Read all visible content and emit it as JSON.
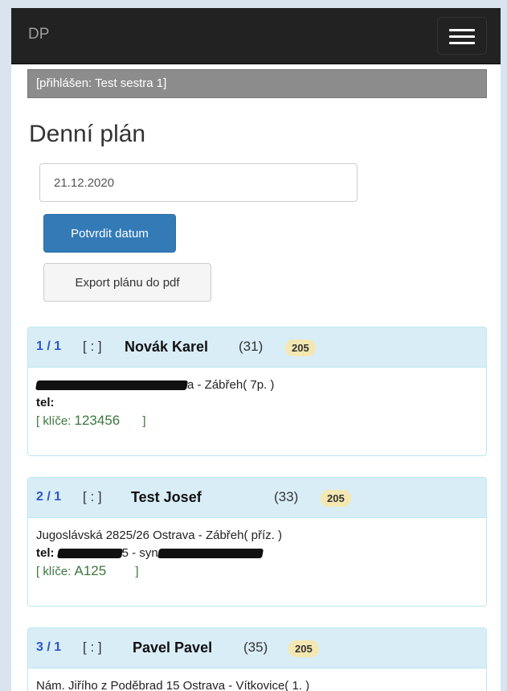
{
  "navbar": {
    "brand": "DP",
    "menu_icon": "hamburger-menu-icon"
  },
  "logged_in": "[přihlášen: Test sestra 1]",
  "page_title": "Denní plán",
  "date_input": {
    "value": "21.12.2020"
  },
  "buttons": {
    "confirm_label": "Potvrdit datum",
    "export_label": "Export plánu do pdf"
  },
  "colors": {
    "navbar": "#222222",
    "primary_button": "#337ab7",
    "panel_heading": "#d9edf7",
    "order_text": "#2c57c5",
    "keys_text": "#3c763d",
    "badge": "#f3e8b1"
  },
  "patients": [
    {
      "order": "1 / 1",
      "flag": "[ : ]",
      "name": "Novák Karel",
      "age": "(31)",
      "badge": "205",
      "address_suffix": "a - Zábřeh( 7p. )",
      "tel_label": "tel:",
      "tel_value": "",
      "keys_prefix": "[ klíče: ",
      "keys_value": "123456",
      "keys_suffix": " ]"
    },
    {
      "order": "2 / 1",
      "flag": "[ : ]",
      "name": "Test Josef",
      "age": "(33)",
      "badge": "205",
      "address": "Jugoslávská 2825/26 Ostrava - Zábřeh( příz. )",
      "tel_label": "tel:",
      "tel_middle": "5 - syn",
      "keys_prefix": "[ klíče: ",
      "keys_value": "A125",
      "keys_suffix": " ]"
    },
    {
      "order": "3 / 1",
      "flag": "[ : ]",
      "name": "Pavel Pavel",
      "age": "(35)",
      "badge": "205",
      "address": "Nám. Jiřího z Poděbrad 15 Ostrava - Vítkovice( 1. )"
    }
  ]
}
